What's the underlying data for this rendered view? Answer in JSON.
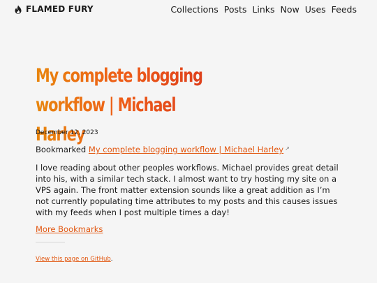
{
  "header": {
    "brand": "FLAMED FURY",
    "brand_icon": "flame-icon",
    "nav": [
      "Collections",
      "Posts",
      "Links",
      "Now",
      "Uses",
      "Feeds"
    ]
  },
  "post": {
    "title_line1": "My complete blogging",
    "title_line2": "workflow | Michael Harley",
    "date": "December 12, 2023",
    "bookmarked_prefix": "Bookmarked",
    "bookmark_link": "My complete blogging workflow | Michael Harley",
    "external_icon": "external-link-icon",
    "body": "I love reading about other peoples workflows. Michael provides great detail into his, with a similar tech stack. I almost want to try hosting my site on a VPS again. The front matter extension sounds like a great addition as I’m not currently populating time attributes to my posts and this causes issues with my feeds when I post multiple times a day!",
    "more_link": "More Bookmarks"
  },
  "footer": {
    "link": "View this page on GitHub",
    "suffix": "."
  },
  "colors": {
    "accent": "#e2560f",
    "title_gradient_start": "#e8860e",
    "title_gradient_end": "#d9381e",
    "background": "#f5f5f5"
  }
}
